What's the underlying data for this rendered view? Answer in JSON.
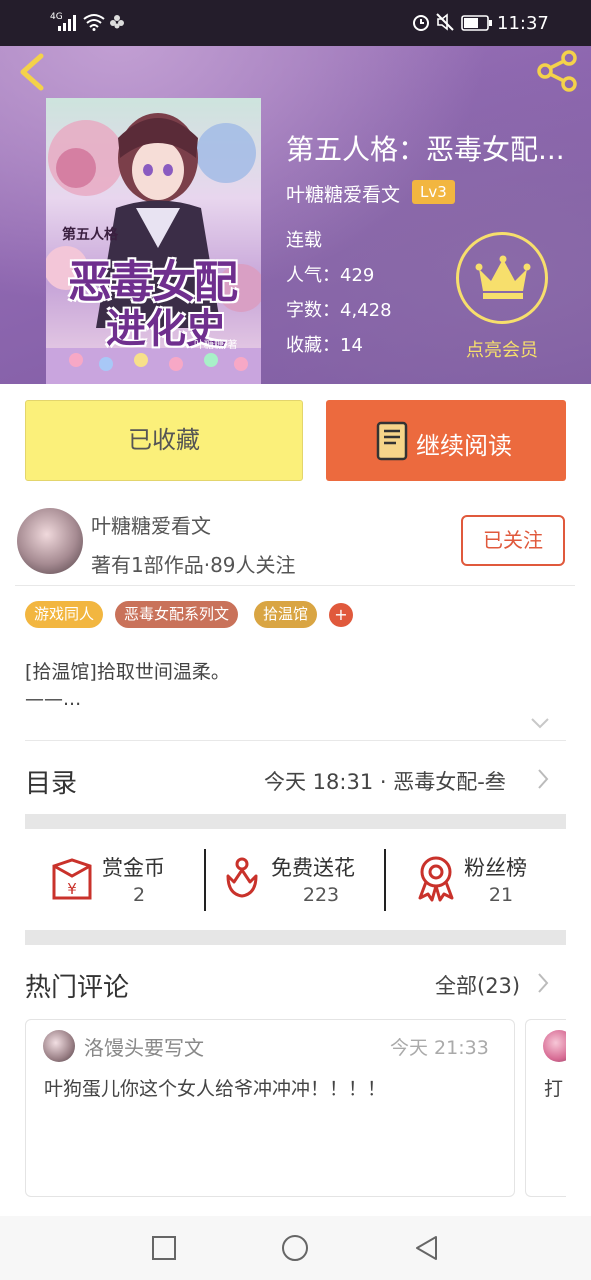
{
  "status_bar": {
    "signal": "4G",
    "time": "11:37"
  },
  "book": {
    "title": "第五人格：恶毒女配...",
    "author": "叶糖糖爱看文",
    "level": "Lv3",
    "status": "连载",
    "popularity": "人气：429",
    "word_count": "字数：4,428",
    "favorites": "收藏：14",
    "cover_title_line1": "第五人格",
    "cover_title_line2": "恶毒女配",
    "cover_title_line3": "进化史",
    "cover_author": "叶糖糖/著"
  },
  "vip": {
    "label": "点亮会员"
  },
  "actions": {
    "favorite": "已收藏",
    "continue_read": "继续阅读"
  },
  "author_card": {
    "name": "叶糖糖爱看文",
    "stats": "著有1部作品·89人关注",
    "follow": "已关注"
  },
  "tags": [
    {
      "label": "游戏同人",
      "color": "#f2b640"
    },
    {
      "label": "恶毒女配系列文",
      "color": "#c9725a"
    },
    {
      "label": "拾温馆",
      "color": "#d9a543"
    }
  ],
  "tag_add": "+",
  "intro": {
    "line1": "[拾温馆]拾取世间温柔。",
    "line2": "——..."
  },
  "catalog": {
    "label": "目录",
    "latest": "今天 18:31 · 恶毒女配-叁"
  },
  "stats": [
    {
      "label": "赏金币",
      "value": "2",
      "icon": "red-envelope-icon"
    },
    {
      "label": "免费送花",
      "value": "223",
      "icon": "flower-icon"
    },
    {
      "label": "粉丝榜",
      "value": "21",
      "icon": "medal-icon"
    }
  ],
  "comments": {
    "title": "热门评论",
    "all": "全部(23)",
    "items": [
      {
        "user": "洛馒头要写文",
        "time": "今天 21:33",
        "text": "叶狗蛋儿你这个女人给爷冲冲冲！！！！"
      },
      {
        "user": "",
        "time": "",
        "text": "打"
      }
    ]
  },
  "colors": {
    "accent_orange": "#ec6a3e",
    "favorite_yellow": "#fbf07a",
    "gold": "#f7df6c"
  }
}
